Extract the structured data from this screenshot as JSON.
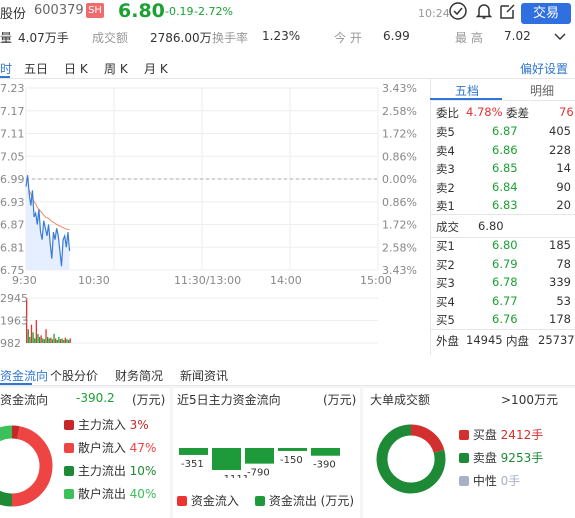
{
  "header": {
    "name": "股份",
    "code": "600379",
    "exchange": "SH",
    "price": "6.80",
    "change": "-0.19",
    "change_pct": "-2.72%",
    "time": "10:24",
    "trade_label": "交易"
  },
  "stats": [
    {
      "label": "量",
      "value": "4.07万手"
    },
    {
      "label": "成交额",
      "value": "2786.00万"
    },
    {
      "label": "换手率",
      "value": "1.23%"
    },
    {
      "label": "今  开",
      "value": "6.99"
    },
    {
      "label": "最  高",
      "value": "7.02"
    }
  ],
  "chart_tabs": [
    "时",
    "五日",
    "日 K",
    "周 K",
    "月 K"
  ],
  "pref_label": "偏好设置",
  "chart_data": {
    "type": "line",
    "left_axis": [
      "7.23",
      "7.17",
      "7.11",
      "7.05",
      "6.99",
      "6.93",
      "6.87",
      "6.81",
      "6.75"
    ],
    "right_axis": [
      "3.43%",
      "2.58%",
      "1.72%",
      "0.86%",
      "0.00%",
      "0.86%",
      "1.72%",
      "2.58%",
      "3.43%"
    ],
    "x_labels": [
      "9:30",
      "10:30",
      "11:30/13:00",
      "14:00",
      "15:00"
    ],
    "prev_close": 6.99,
    "ylim": [
      6.75,
      7.23
    ],
    "price": [
      6.97,
      7.0,
      6.95,
      6.92,
      6.96,
      6.89,
      6.9,
      6.87,
      6.91,
      6.85,
      6.83,
      6.88,
      6.86,
      6.84,
      6.87,
      6.82,
      6.78,
      6.85,
      6.83,
      6.86,
      6.84,
      6.8,
      6.76,
      6.83,
      6.84,
      6.81,
      6.85,
      6.8
    ],
    "avg": [
      6.97,
      6.97,
      6.96,
      6.95,
      6.94,
      6.93,
      6.925,
      6.915,
      6.91,
      6.905,
      6.9,
      6.895,
      6.89,
      6.888,
      6.886,
      6.882,
      6.878,
      6.876,
      6.873,
      6.87,
      6.868,
      6.866,
      6.864,
      6.862,
      6.86,
      6.858,
      6.857,
      6.856
    ],
    "vol_labels": [
      "2945",
      "1963",
      "982",
      "手"
    ],
    "volume": [
      2945,
      900,
      400,
      1200,
      700,
      300,
      1500,
      600,
      400,
      500,
      300,
      250,
      900,
      400,
      300,
      350,
      250,
      600,
      300,
      200,
      400,
      250,
      300,
      200,
      350,
      250,
      200,
      300
    ]
  },
  "book_tabs": [
    "五档",
    "明细"
  ],
  "book": {
    "wb_label": "委比",
    "wb": "4.78%",
    "wc_label": "委差",
    "wc": "76",
    "asks": [
      {
        "l": "卖5",
        "p": "6.87",
        "v": "405"
      },
      {
        "l": "卖4",
        "p": "6.86",
        "v": "228"
      },
      {
        "l": "卖3",
        "p": "6.85",
        "v": "14"
      },
      {
        "l": "卖2",
        "p": "6.84",
        "v": "90"
      },
      {
        "l": "卖1",
        "p": "6.83",
        "v": "20"
      }
    ],
    "deal_label": "成交",
    "deal": "6.80",
    "bids": [
      {
        "l": "买1",
        "p": "6.80",
        "v": "185"
      },
      {
        "l": "买2",
        "p": "6.79",
        "v": "78"
      },
      {
        "l": "买3",
        "p": "6.78",
        "v": "339"
      },
      {
        "l": "买4",
        "p": "6.77",
        "v": "53"
      },
      {
        "l": "买5",
        "p": "6.76",
        "v": "178"
      }
    ],
    "outer_label": "外盘",
    "outer": "14945",
    "inner_label": "内盘",
    "inner": "25737"
  },
  "section_tabs": [
    "资金流向",
    "个股分价",
    "财务简况",
    "新闻资讯"
  ],
  "flow": {
    "title": "资金流向",
    "value": "-390.2",
    "unit": "(万元)",
    "legend": [
      {
        "label": "主力流入",
        "value": "3%",
        "color": "#c62828"
      },
      {
        "label": "散户流入",
        "value": "47%",
        "color": "#ee4444"
      },
      {
        "label": "主力流出",
        "value": "10%",
        "color": "#1e8a35"
      },
      {
        "label": "散户流出",
        "value": "40%",
        "color": "#3cc05a"
      }
    ]
  },
  "five_day": {
    "title": "近5日主力资金流向",
    "unit": "(万元)",
    "values": [
      -351,
      -1111,
      -790,
      -150,
      -390
    ],
    "labels": [
      "-351",
      "-1111",
      "-790",
      "-150",
      "-390"
    ],
    "in_label": "资金流入",
    "out_label": "资金流出",
    "unit2": "(万元)"
  },
  "big": {
    "title": "大单成交额",
    "threshold": ">100万元",
    "legend": [
      {
        "label": "买盘",
        "value": "2412手",
        "color": "#d32f2f"
      },
      {
        "label": "卖盘",
        "value": "9253手",
        "color": "#1e8a35"
      },
      {
        "label": "中性",
        "value": "0手",
        "color": "#aab0c8"
      }
    ]
  }
}
